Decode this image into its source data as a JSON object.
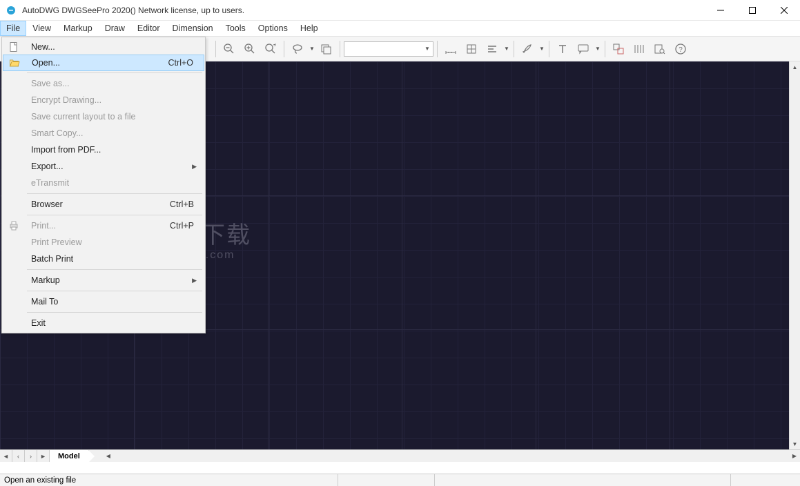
{
  "window": {
    "title": "AutoDWG DWGSeePro 2020() Network license, up to  users."
  },
  "menubar": [
    "File",
    "View",
    "Markup",
    "Draw",
    "Editor",
    "Dimension",
    "Tools",
    "Options",
    "Help"
  ],
  "menubar_active_index": 0,
  "file_menu": [
    {
      "kind": "item",
      "label": "New...",
      "icon": "new-file-icon"
    },
    {
      "kind": "item",
      "label": "Open...",
      "shortcut": "Ctrl+O",
      "icon": "open-folder-icon",
      "hover": true
    },
    {
      "kind": "sep"
    },
    {
      "kind": "item",
      "label": "Save as...",
      "disabled": true
    },
    {
      "kind": "item",
      "label": "Encrypt  Drawing...",
      "disabled": true
    },
    {
      "kind": "item",
      "label": "Save current layout to a file",
      "disabled": true
    },
    {
      "kind": "item",
      "label": "Smart Copy...",
      "disabled": true
    },
    {
      "kind": "item",
      "label": "Import from PDF..."
    },
    {
      "kind": "item",
      "label": "Export...",
      "submenu": true
    },
    {
      "kind": "item",
      "label": "eTransmit",
      "disabled": true
    },
    {
      "kind": "sep"
    },
    {
      "kind": "item",
      "label": "Browser",
      "shortcut": "Ctrl+B"
    },
    {
      "kind": "sep"
    },
    {
      "kind": "item",
      "label": "Print...",
      "shortcut": "Ctrl+P",
      "icon": "print-icon",
      "disabled": true
    },
    {
      "kind": "item",
      "label": "Print Preview",
      "disabled": true
    },
    {
      "kind": "item",
      "label": "Batch Print"
    },
    {
      "kind": "sep"
    },
    {
      "kind": "item",
      "label": "Markup",
      "submenu": true
    },
    {
      "kind": "sep"
    },
    {
      "kind": "item",
      "label": "Mail To"
    },
    {
      "kind": "sep"
    },
    {
      "kind": "item",
      "label": "Exit"
    }
  ],
  "toolbar_icons": [
    "zoom-out-icon",
    "zoom-in-icon",
    "zoom-extents-icon",
    "sep",
    "lasso-icon",
    "dd",
    "layers-icon",
    "sep",
    "layercombo",
    "sep",
    "measure-icon",
    "measure-area-icon",
    "align-icon",
    "dd",
    "sep",
    "brush-icon",
    "dd",
    "sep",
    "text-icon",
    "comment-icon",
    "dd",
    "sep",
    "compare-icon",
    "hatch-icon",
    "find-icon",
    "help-icon"
  ],
  "tab": {
    "label": "Model"
  },
  "status": {
    "message": "Open an existing file"
  },
  "watermark": {
    "line1": "安下载",
    "line2": "anxz.com"
  }
}
